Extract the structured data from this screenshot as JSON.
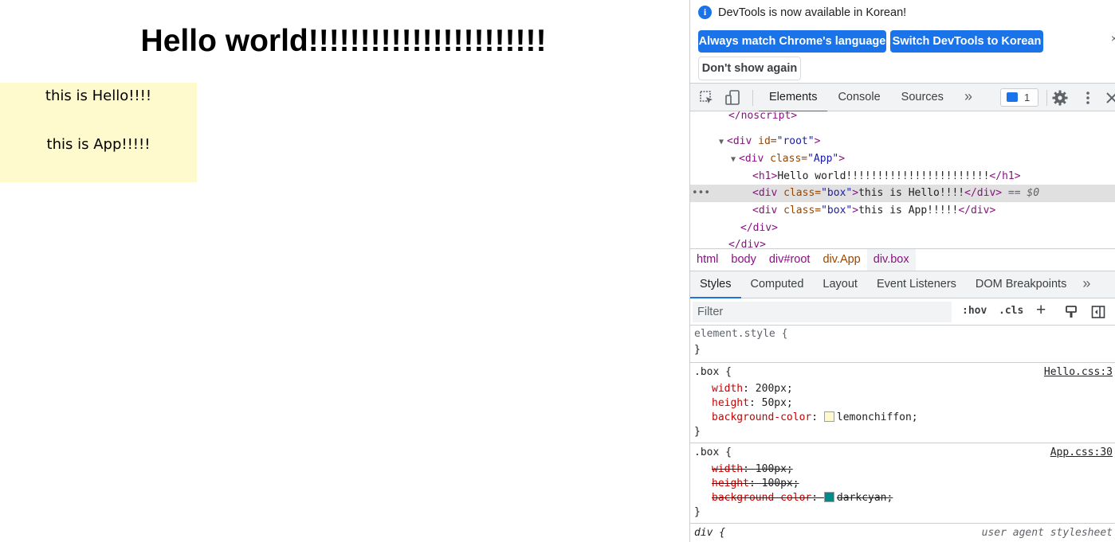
{
  "viewport": {
    "heading": "Hello world!!!!!!!!!!!!!!!!!!!!!!!",
    "boxes": [
      "this is Hello!!!!",
      "this is App!!!!!"
    ],
    "box_color": "#fffacd"
  },
  "devtools": {
    "infobar": {
      "message": "DevTools is now available in Korean!",
      "match_label": "Always match Chrome's language",
      "switch_label": "Switch DevTools to Korean",
      "dont_show_label": "Don't show again",
      "close": "×"
    },
    "toolbar": {
      "tabs": [
        "Elements",
        "Console",
        "Sources"
      ],
      "more": "»",
      "issues_count": "1"
    },
    "dom": {
      "line0": "</noscript>",
      "root_open_tag": "<div",
      "root_attr": " id=",
      "root_val": "\"root\"",
      "app_open_tag": "<div",
      "app_attr": " class=",
      "app_val": "\"App\"",
      "h1_open": "<h1>",
      "h1_text": "Hello world!!!!!!!!!!!!!!!!!!!!!!!",
      "h1_close": "</h1>",
      "box_open": "<div",
      "box_attr": " class=",
      "box_val": "\"box\"",
      "box_gt": ">",
      "box1_text": "this is Hello!!!!",
      "box2_text": "this is App!!!!!",
      "div_close": "</div>",
      "selected_suffix": " == $0",
      "app_close": "</div>",
      "root_close": "</div>",
      "dots": "•••",
      "tri_open": "▼",
      "gt": ">",
      "app_gt": ">"
    },
    "breadcrumbs": [
      "html",
      "body",
      "div#root",
      "div.App",
      "div.box"
    ],
    "subtabs": [
      "Styles",
      "Computed",
      "Layout",
      "Event Listeners",
      "DOM Breakpoints"
    ],
    "subtabs_more": "»",
    "filter": {
      "placeholder": "Filter",
      "hov": ":hov",
      "cls": ".cls",
      "plus": "+"
    },
    "styles": {
      "element_style": "element.style {",
      "close_brace": "}",
      "rule1": {
        "selector": ".box {",
        "source": "Hello.css:3",
        "props": [
          {
            "name": "width",
            "value": "200px;"
          },
          {
            "name": "height",
            "value": "50px;"
          },
          {
            "name": "background-color",
            "value": "lemonchiffon;",
            "swatch": "#fffacd"
          }
        ]
      },
      "rule2": {
        "selector": ".box {",
        "source": "App.css:30",
        "props": [
          {
            "name": "width",
            "value": "100px;"
          },
          {
            "name": "height",
            "value": "100px;"
          },
          {
            "name": "background-color",
            "value": "darkcyan;",
            "swatch": "#008b8b"
          }
        ]
      },
      "rule3": {
        "selector": "div {",
        "source": "user agent stylesheet"
      },
      "colon": ": "
    }
  }
}
